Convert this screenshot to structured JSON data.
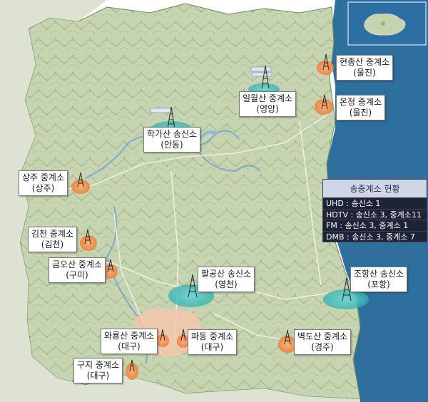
{
  "map": {
    "colors": {
      "land": "#c8d5b4",
      "mountain": "#a7bb90",
      "sea": "#2e6e9c",
      "water": "#8fb6d6",
      "city": "#f6c8b0",
      "road": "#f2f0e8",
      "transmitter": "#36b4b4",
      "repeater": "#f08a3c"
    }
  },
  "inset": {
    "description_icon": "island-inset-map"
  },
  "sites": [
    {
      "name": "현종산 중계소",
      "region": "(울진)",
      "type": "repeater"
    },
    {
      "name": "온정 중계소",
      "region": "(울진)",
      "type": "repeater"
    },
    {
      "name": "일월산 중계소",
      "region": "(영양)",
      "type": "repeater"
    },
    {
      "name": "학가산 송신소",
      "region": "(안동)",
      "type": "transmitter"
    },
    {
      "name": "상주 중계소",
      "region": "(상주)",
      "type": "repeater"
    },
    {
      "name": "김천 중계소",
      "region": "(김천)",
      "type": "repeater"
    },
    {
      "name": "금오산 중계소",
      "region": "(구미)",
      "type": "repeater"
    },
    {
      "name": "팔공산 송신소",
      "region": "(영천)",
      "type": "transmitter"
    },
    {
      "name": "조항산 송신소",
      "region": "(포항)",
      "type": "transmitter"
    },
    {
      "name": "와룡산 중계소",
      "region": "(대구)",
      "type": "repeater"
    },
    {
      "name": "파동 중계소",
      "region": "(대구)",
      "type": "repeater"
    },
    {
      "name": "벽도산 중계소",
      "region": "(경주)",
      "type": "repeater"
    },
    {
      "name": "구지 중계소",
      "region": "(대구)",
      "type": "repeater"
    }
  ],
  "status": {
    "title": "송중계소 현황",
    "rows": [
      "UHD : 송신소 1",
      "HDTV : 송신소 3, 중계소11",
      "FM : 송신소 3, 중계소 1",
      "DMB : 송신소 3, 중계소 7"
    ]
  }
}
